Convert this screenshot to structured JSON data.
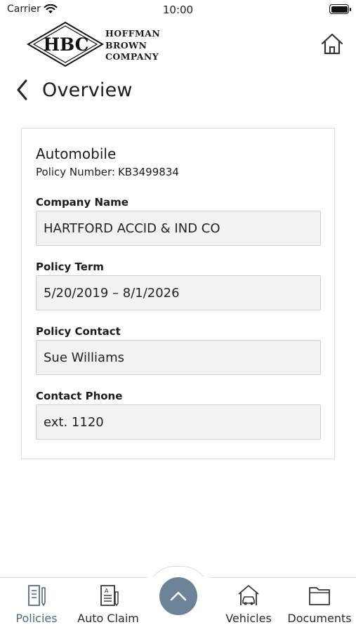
{
  "status_bar": {
    "carrier": "Carrier",
    "time": "10:00"
  },
  "header": {
    "logo_initials": "HBC",
    "logo_name_lines": [
      "HOFFMAN",
      "BROWN",
      "COMPANY"
    ],
    "home_icon": "home-icon"
  },
  "nav": {
    "title": "Overview",
    "back_icon": "chevron-left-icon"
  },
  "policy": {
    "type": "Automobile",
    "number_label": "Policy Number:",
    "number": "KB3499834",
    "fields": [
      {
        "label": "Company Name",
        "value": "HARTFORD ACCID & IND CO"
      },
      {
        "label": "Policy Term",
        "value": "5/20/2019 – 8/1/2026"
      },
      {
        "label": "Policy Contact",
        "value": "Sue Williams"
      },
      {
        "label": "Contact Phone",
        "value": "ext. 1120"
      }
    ]
  },
  "tabs": [
    {
      "label": "Policies",
      "icon": "policies-icon",
      "active": true
    },
    {
      "label": "Auto Claim",
      "icon": "auto-claim-icon",
      "active": false
    },
    {
      "label": "",
      "icon": "chevron-up-icon",
      "active": false
    },
    {
      "label": "Vehicles",
      "icon": "vehicles-icon",
      "active": false
    },
    {
      "label": "Documents",
      "icon": "documents-icon",
      "active": false
    }
  ],
  "colors": {
    "accent": "#6d8397",
    "active_tab": "#4f6b85",
    "field_background": "#f2f2f2"
  }
}
